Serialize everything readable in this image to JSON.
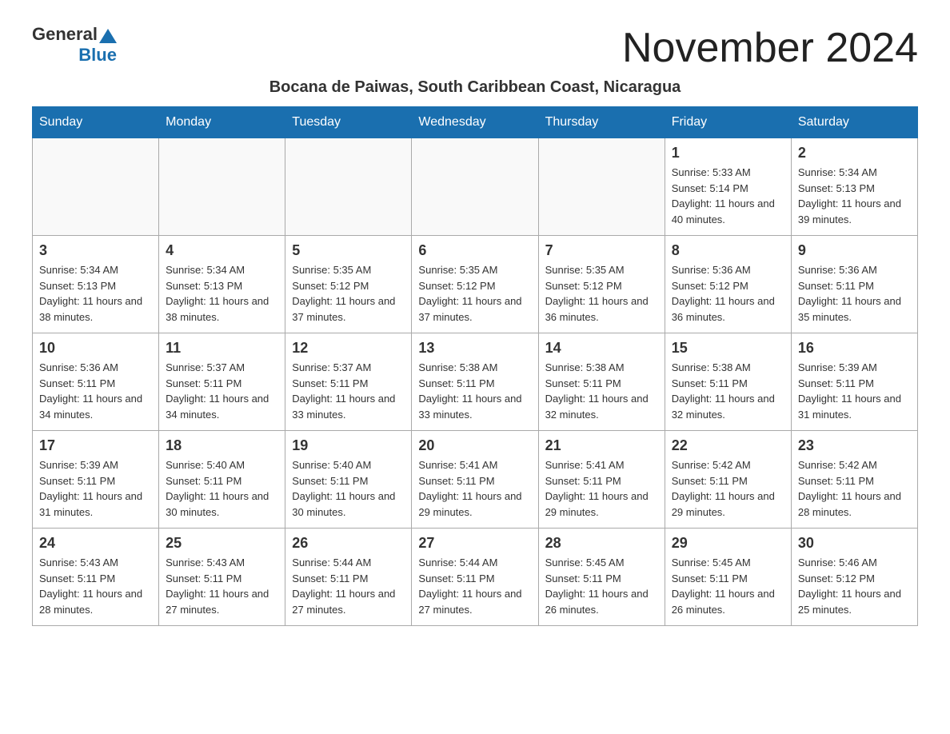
{
  "header": {
    "logo_general": "General",
    "logo_blue": "Blue",
    "month_title": "November 2024",
    "subtitle": "Bocana de Paiwas, South Caribbean Coast, Nicaragua"
  },
  "days_of_week": [
    "Sunday",
    "Monday",
    "Tuesday",
    "Wednesday",
    "Thursday",
    "Friday",
    "Saturday"
  ],
  "weeks": [
    [
      {
        "day": "",
        "info": ""
      },
      {
        "day": "",
        "info": ""
      },
      {
        "day": "",
        "info": ""
      },
      {
        "day": "",
        "info": ""
      },
      {
        "day": "",
        "info": ""
      },
      {
        "day": "1",
        "info": "Sunrise: 5:33 AM\nSunset: 5:14 PM\nDaylight: 11 hours and 40 minutes."
      },
      {
        "day": "2",
        "info": "Sunrise: 5:34 AM\nSunset: 5:13 PM\nDaylight: 11 hours and 39 minutes."
      }
    ],
    [
      {
        "day": "3",
        "info": "Sunrise: 5:34 AM\nSunset: 5:13 PM\nDaylight: 11 hours and 38 minutes."
      },
      {
        "day": "4",
        "info": "Sunrise: 5:34 AM\nSunset: 5:13 PM\nDaylight: 11 hours and 38 minutes."
      },
      {
        "day": "5",
        "info": "Sunrise: 5:35 AM\nSunset: 5:12 PM\nDaylight: 11 hours and 37 minutes."
      },
      {
        "day": "6",
        "info": "Sunrise: 5:35 AM\nSunset: 5:12 PM\nDaylight: 11 hours and 37 minutes."
      },
      {
        "day": "7",
        "info": "Sunrise: 5:35 AM\nSunset: 5:12 PM\nDaylight: 11 hours and 36 minutes."
      },
      {
        "day": "8",
        "info": "Sunrise: 5:36 AM\nSunset: 5:12 PM\nDaylight: 11 hours and 36 minutes."
      },
      {
        "day": "9",
        "info": "Sunrise: 5:36 AM\nSunset: 5:11 PM\nDaylight: 11 hours and 35 minutes."
      }
    ],
    [
      {
        "day": "10",
        "info": "Sunrise: 5:36 AM\nSunset: 5:11 PM\nDaylight: 11 hours and 34 minutes."
      },
      {
        "day": "11",
        "info": "Sunrise: 5:37 AM\nSunset: 5:11 PM\nDaylight: 11 hours and 34 minutes."
      },
      {
        "day": "12",
        "info": "Sunrise: 5:37 AM\nSunset: 5:11 PM\nDaylight: 11 hours and 33 minutes."
      },
      {
        "day": "13",
        "info": "Sunrise: 5:38 AM\nSunset: 5:11 PM\nDaylight: 11 hours and 33 minutes."
      },
      {
        "day": "14",
        "info": "Sunrise: 5:38 AM\nSunset: 5:11 PM\nDaylight: 11 hours and 32 minutes."
      },
      {
        "day": "15",
        "info": "Sunrise: 5:38 AM\nSunset: 5:11 PM\nDaylight: 11 hours and 32 minutes."
      },
      {
        "day": "16",
        "info": "Sunrise: 5:39 AM\nSunset: 5:11 PM\nDaylight: 11 hours and 31 minutes."
      }
    ],
    [
      {
        "day": "17",
        "info": "Sunrise: 5:39 AM\nSunset: 5:11 PM\nDaylight: 11 hours and 31 minutes."
      },
      {
        "day": "18",
        "info": "Sunrise: 5:40 AM\nSunset: 5:11 PM\nDaylight: 11 hours and 30 minutes."
      },
      {
        "day": "19",
        "info": "Sunrise: 5:40 AM\nSunset: 5:11 PM\nDaylight: 11 hours and 30 minutes."
      },
      {
        "day": "20",
        "info": "Sunrise: 5:41 AM\nSunset: 5:11 PM\nDaylight: 11 hours and 29 minutes."
      },
      {
        "day": "21",
        "info": "Sunrise: 5:41 AM\nSunset: 5:11 PM\nDaylight: 11 hours and 29 minutes."
      },
      {
        "day": "22",
        "info": "Sunrise: 5:42 AM\nSunset: 5:11 PM\nDaylight: 11 hours and 29 minutes."
      },
      {
        "day": "23",
        "info": "Sunrise: 5:42 AM\nSunset: 5:11 PM\nDaylight: 11 hours and 28 minutes."
      }
    ],
    [
      {
        "day": "24",
        "info": "Sunrise: 5:43 AM\nSunset: 5:11 PM\nDaylight: 11 hours and 28 minutes."
      },
      {
        "day": "25",
        "info": "Sunrise: 5:43 AM\nSunset: 5:11 PM\nDaylight: 11 hours and 27 minutes."
      },
      {
        "day": "26",
        "info": "Sunrise: 5:44 AM\nSunset: 5:11 PM\nDaylight: 11 hours and 27 minutes."
      },
      {
        "day": "27",
        "info": "Sunrise: 5:44 AM\nSunset: 5:11 PM\nDaylight: 11 hours and 27 minutes."
      },
      {
        "day": "28",
        "info": "Sunrise: 5:45 AM\nSunset: 5:11 PM\nDaylight: 11 hours and 26 minutes."
      },
      {
        "day": "29",
        "info": "Sunrise: 5:45 AM\nSunset: 5:11 PM\nDaylight: 11 hours and 26 minutes."
      },
      {
        "day": "30",
        "info": "Sunrise: 5:46 AM\nSunset: 5:12 PM\nDaylight: 11 hours and 25 minutes."
      }
    ]
  ]
}
